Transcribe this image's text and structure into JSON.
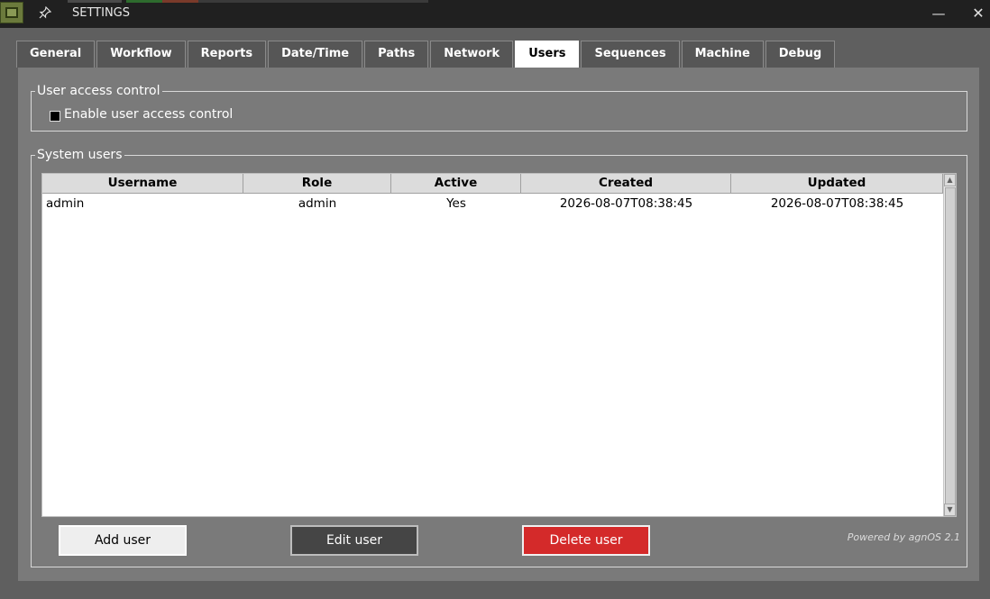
{
  "window": {
    "title": "SETTINGS",
    "minimize_symbol": "—",
    "close_symbol": "✕",
    "pin_symbol": "📌"
  },
  "tabs": [
    {
      "label": "General",
      "active": false
    },
    {
      "label": "Workflow",
      "active": false
    },
    {
      "label": "Reports",
      "active": false
    },
    {
      "label": "Date/Time",
      "active": false
    },
    {
      "label": "Paths",
      "active": false
    },
    {
      "label": "Network",
      "active": false
    },
    {
      "label": "Users",
      "active": true
    },
    {
      "label": "Sequences",
      "active": false
    },
    {
      "label": "Machine",
      "active": false
    },
    {
      "label": "Debug",
      "active": false
    }
  ],
  "access_control": {
    "legend": "User access control",
    "checkbox_label": "Enable user access control",
    "checked": false
  },
  "system_users": {
    "legend": "System users",
    "columns": [
      "Username",
      "Role",
      "Active",
      "Created",
      "Updated"
    ],
    "rows": [
      [
        "admin",
        "admin",
        "Yes",
        "2026-08-07T08:38:45",
        "2026-08-07T08:38:45"
      ]
    ]
  },
  "buttons": {
    "add": "Add user",
    "edit": "Edit user",
    "delete": "Delete user"
  },
  "footer": {
    "powered_by": "Powered by agnOS 2.1"
  },
  "colors": {
    "delete_button": "#d42a2a",
    "edit_button": "#454545",
    "active_tab": "#ffffff"
  }
}
